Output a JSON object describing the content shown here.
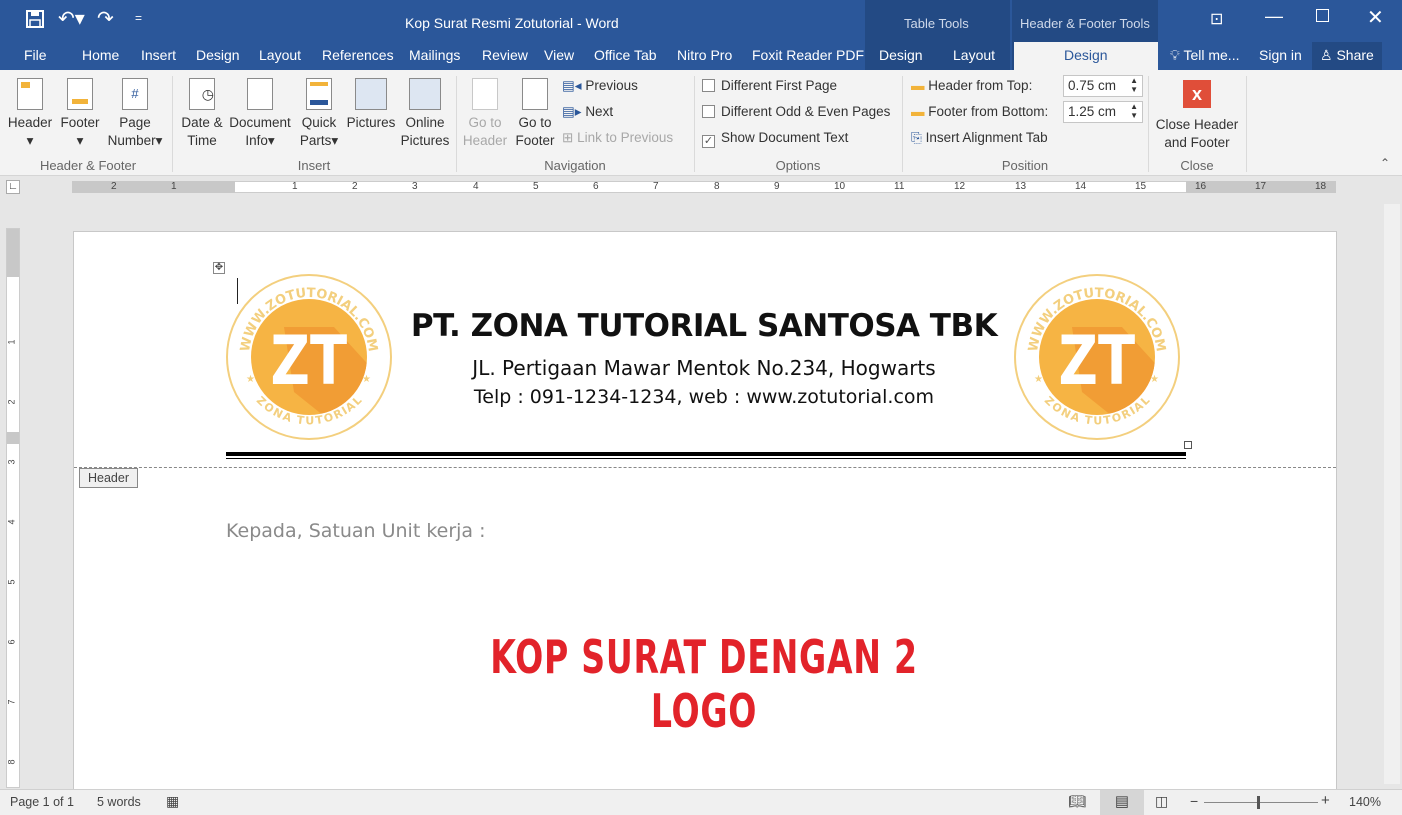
{
  "window": {
    "title": "Kop Surat Resmi Zotutorial - Word",
    "contextual": [
      "Table Tools",
      "Header & Footer Tools"
    ]
  },
  "qat": {
    "save": "save-icon",
    "undo": "undo-icon",
    "redo": "redo-icon",
    "customize": "="
  },
  "tabs": [
    "File",
    "Home",
    "Insert",
    "Design",
    "Layout",
    "References",
    "Mailings",
    "Review",
    "View",
    "Office Tab",
    "Nitro Pro",
    "Foxit Reader PDF",
    "Design",
    "Layout",
    "Design"
  ],
  "active_tab": "Design",
  "tell_me": "Tell me...",
  "sign_in": "Sign in",
  "share": "Share",
  "ribbon": {
    "header_footer": {
      "header": "Header",
      "footer": "Footer",
      "page": "Page",
      "number": "Number",
      "group": "Header & Footer"
    },
    "insert": {
      "date1": "Date &",
      "date2": "Time",
      "doc1": "Document",
      "doc2": "Info",
      "quick1": "Quick",
      "quick2": "Parts",
      "pictures": "Pictures",
      "online1": "Online",
      "online2": "Pictures",
      "group": "Insert"
    },
    "navigation": {
      "goh1": "Go to",
      "goh2": "Header",
      "gof1": "Go to",
      "gof2": "Footer",
      "previous": "Previous",
      "next": "Next",
      "link": "Link to Previous",
      "group": "Navigation"
    },
    "options": {
      "first": "Different First Page",
      "oddeven": "Different Odd & Even Pages",
      "show": "Show Document Text",
      "show_checked": true,
      "group": "Options"
    },
    "position": {
      "hft": "Header from Top:",
      "hft_val": "0.75 cm",
      "ffb": "Footer from Bottom:",
      "ffb_val": "1.25 cm",
      "align": "Insert Alignment Tab",
      "group": "Position"
    },
    "close": {
      "l1": "Close Header",
      "l2": "and Footer",
      "group": "Close"
    }
  },
  "ruler": {
    "h": [
      "2",
      "1",
      "1",
      "2",
      "3",
      "4",
      "5",
      "6",
      "7",
      "8",
      "9",
      "10",
      "11",
      "12",
      "13",
      "14",
      "15",
      "16",
      "17",
      "18"
    ],
    "v": [
      "1",
      "2",
      "3",
      "4",
      "5",
      "6",
      "7",
      "8"
    ]
  },
  "document": {
    "company": "PT. ZONA TUTORIAL SANTOSA TBK",
    "address": "JL. Pertigaan Mawar Mentok No.234, Hogwarts",
    "contact": "Telp : 091-1234-1234, web : www.zotutorial.com",
    "header_tag": "Header",
    "body_text": "Kepada, Satuan Unit kerja :",
    "banner": "KOP SURAT DENGAN 2 LOGO",
    "banner_color": "#e2232a",
    "logo": {
      "top": "WWW.ZOTUTORIAL.COM",
      "bottom": "ZONA TUTORIAL",
      "mark": "ZT"
    }
  },
  "status": {
    "page": "Page 1 of 1",
    "words": "5 words",
    "zoom": "140%",
    "zoom_level": 140
  },
  "colors": {
    "brand": "#2b579a",
    "logo": "#f6b444"
  }
}
